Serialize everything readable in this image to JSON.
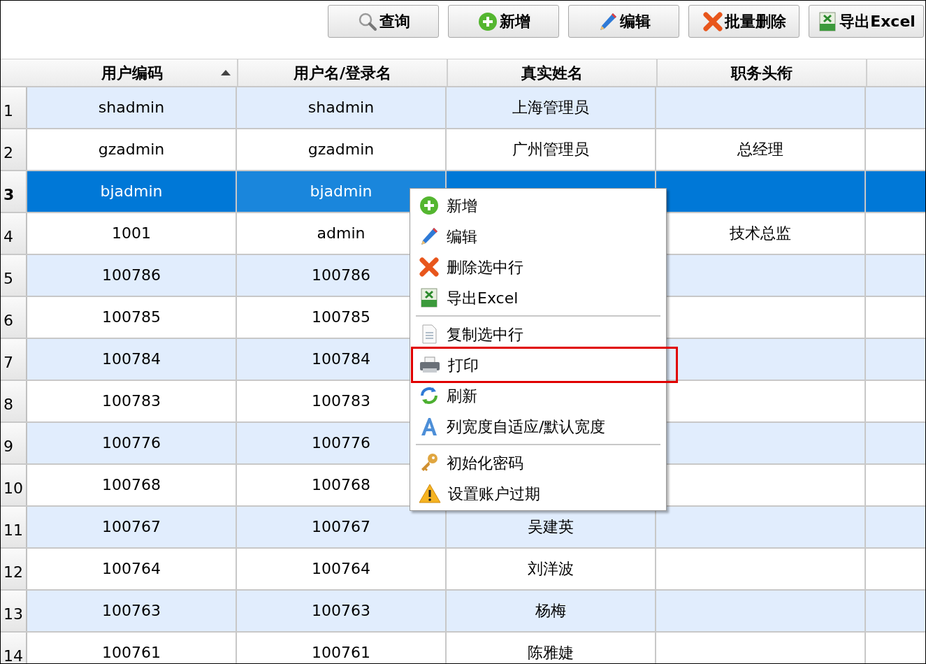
{
  "toolbar": [
    {
      "label": "查询"
    },
    {
      "label": "新增"
    },
    {
      "label": "编辑"
    },
    {
      "label": "批量删除"
    },
    {
      "label": "导出Excel"
    }
  ],
  "table": {
    "columns": [
      {
        "label": "用户编码",
        "sort_ascending": true
      },
      {
        "label": "用户名/登录名",
        "sort_ascending": false
      },
      {
        "label": "真实姓名",
        "sort_ascending": false
      },
      {
        "label": "职务头衔",
        "sort_ascending": false
      }
    ],
    "rows": [
      {
        "number": "1",
        "selected": false,
        "cells": [
          "shadmin",
          "shadmin",
          "上海管理员",
          ""
        ]
      },
      {
        "number": "2",
        "selected": false,
        "cells": [
          "gzadmin",
          "gzadmin",
          "广州管理员",
          "总经理"
        ]
      },
      {
        "number": "3",
        "selected": true,
        "cells": [
          "bjadmin",
          "bjadmin",
          "",
          ""
        ]
      },
      {
        "number": "4",
        "selected": false,
        "cells": [
          "1001",
          "admin",
          "",
          "技术总监"
        ]
      },
      {
        "number": "5",
        "selected": false,
        "cells": [
          "100786",
          "100786",
          "",
          ""
        ]
      },
      {
        "number": "6",
        "selected": false,
        "cells": [
          "100785",
          "100785",
          "",
          ""
        ]
      },
      {
        "number": "7",
        "selected": false,
        "cells": [
          "100784",
          "100784",
          "",
          ""
        ]
      },
      {
        "number": "8",
        "selected": false,
        "cells": [
          "100783",
          "100783",
          "",
          ""
        ]
      },
      {
        "number": "9",
        "selected": false,
        "cells": [
          "100776",
          "100776",
          "",
          ""
        ]
      },
      {
        "number": "10",
        "selected": false,
        "cells": [
          "100768",
          "100768",
          "",
          ""
        ]
      },
      {
        "number": "11",
        "selected": false,
        "cells": [
          "100767",
          "100767",
          "吴建英",
          ""
        ]
      },
      {
        "number": "12",
        "selected": false,
        "cells": [
          "100764",
          "100764",
          "刘洋波",
          ""
        ]
      },
      {
        "number": "13",
        "selected": false,
        "cells": [
          "100763",
          "100763",
          "杨梅",
          ""
        ]
      },
      {
        "number": "14",
        "selected": false,
        "cells": [
          "100761",
          "100761",
          "陈雅婕",
          ""
        ]
      }
    ]
  },
  "context_menu": {
    "items": [
      {
        "kind": "item",
        "label": "新增",
        "highlighted": false
      },
      {
        "kind": "item",
        "label": "编辑",
        "highlighted": false
      },
      {
        "kind": "item",
        "label": "删除选中行",
        "highlighted": false
      },
      {
        "kind": "item",
        "label": "导出Excel",
        "highlighted": false
      },
      {
        "kind": "separator"
      },
      {
        "kind": "item",
        "label": "复制选中行",
        "highlighted": false
      },
      {
        "kind": "item",
        "label": "打印",
        "highlighted": true
      },
      {
        "kind": "item",
        "label": "刷新",
        "highlighted": false
      },
      {
        "kind": "item",
        "label": "列宽度自适应/默认宽度",
        "highlighted": false
      },
      {
        "kind": "separator"
      },
      {
        "kind": "item",
        "label": "初始化密码",
        "highlighted": false
      },
      {
        "kind": "item",
        "label": "设置账户过期",
        "highlighted": false
      }
    ]
  }
}
